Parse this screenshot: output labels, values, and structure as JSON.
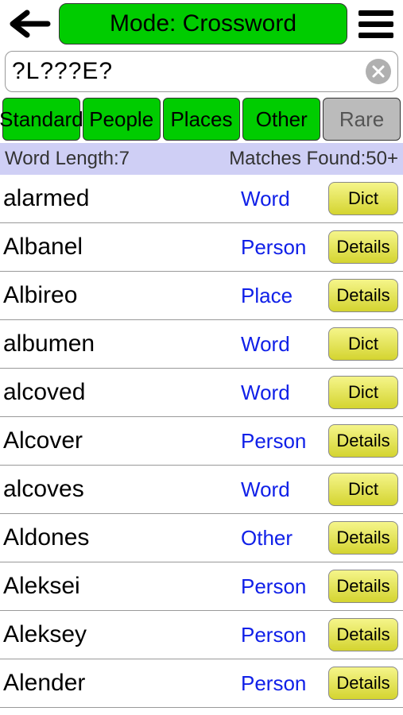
{
  "header": {
    "mode_label": "Mode: Crossword"
  },
  "search": {
    "value": "?L???E?"
  },
  "filters": [
    {
      "label": "Standard",
      "active": true
    },
    {
      "label": "People",
      "active": true
    },
    {
      "label": "Places",
      "active": true
    },
    {
      "label": "Other",
      "active": true
    },
    {
      "label": "Rare",
      "active": false
    }
  ],
  "status": {
    "length_label": "Word Length:7",
    "matches_label": "Matches Found:50+"
  },
  "results": [
    {
      "word": "alarmed",
      "type": "Word",
      "btn": "Dict"
    },
    {
      "word": "Albanel",
      "type": "Person",
      "btn": "Details"
    },
    {
      "word": "Albireo",
      "type": "Place",
      "btn": "Details"
    },
    {
      "word": "albumen",
      "type": "Word",
      "btn": "Dict"
    },
    {
      "word": "alcoved",
      "type": "Word",
      "btn": "Dict"
    },
    {
      "word": "Alcover",
      "type": "Person",
      "btn": "Details"
    },
    {
      "word": "alcoves",
      "type": "Word",
      "btn": "Dict"
    },
    {
      "word": "Aldones",
      "type": "Other",
      "btn": "Details"
    },
    {
      "word": "Aleksei",
      "type": "Person",
      "btn": "Details"
    },
    {
      "word": "Aleksey",
      "type": "Person",
      "btn": "Details"
    },
    {
      "word": "Alender",
      "type": "Person",
      "btn": "Details"
    }
  ]
}
